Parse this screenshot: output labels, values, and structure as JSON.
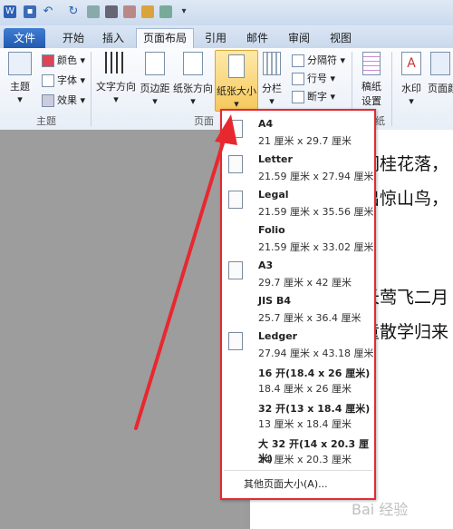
{
  "qat": {
    "app_letter": "W"
  },
  "tabs": [
    "文件",
    "开始",
    "插入",
    "页面布局",
    "引用",
    "邮件",
    "审阅",
    "视图"
  ],
  "ribbon": {
    "theme": {
      "label": "主题",
      "group": "主题",
      "colors": "颜色",
      "fonts": "字体",
      "effects": "效果"
    },
    "page_setup": {
      "text_direction": "文字方向",
      "margins": "页边距",
      "orientation": "纸张方向",
      "size": "纸张大小",
      "columns": "分栏",
      "breaks": "分隔符",
      "line_numbers": "行号",
      "hyphenation": "断字",
      "group": "页面"
    },
    "manuscript": {
      "label1": "稿纸",
      "label2": "设置",
      "group": "纸"
    },
    "watermark": "水印",
    "page_color": "页面颜"
  },
  "document": {
    "lines": [
      "闲桂花落，",
      "出惊山鸟，",
      "长莺飞二月",
      "童散学归来"
    ]
  },
  "paper_menu": {
    "items": [
      {
        "name": "A4",
        "dims": "21 厘米 x 29.7 厘米"
      },
      {
        "name": "Letter",
        "dims": "21.59 厘米 x 27.94 厘米"
      },
      {
        "name": "Legal",
        "dims": "21.59 厘米 x 35.56 厘米"
      },
      {
        "name": "Folio",
        "dims": "21.59 厘米 x 33.02 厘米"
      },
      {
        "name": "A3",
        "dims": "29.7 厘米 x 42 厘米"
      },
      {
        "name": "JIS B4",
        "dims": "25.7 厘米 x 36.4 厘米"
      },
      {
        "name": "Ledger",
        "dims": "27.94 厘米 x 43.18 厘米"
      },
      {
        "name": "16 开(18.4 x 26 厘米)",
        "dims": "18.4 厘米 x 26 厘米"
      },
      {
        "name": "32 开(13 x 18.4 厘米)",
        "dims": "13 厘米 x 18.4 厘米"
      },
      {
        "name": "大 32 开(14 x 20.3 厘米)",
        "dims": "14 厘米 x 20.3 厘米"
      }
    ],
    "more": "其他页面大小(A)..."
  },
  "watermark_text": "Bai 经验",
  "colors": {
    "annotation": "#e8282f",
    "file_tab": "#2b63b8"
  }
}
